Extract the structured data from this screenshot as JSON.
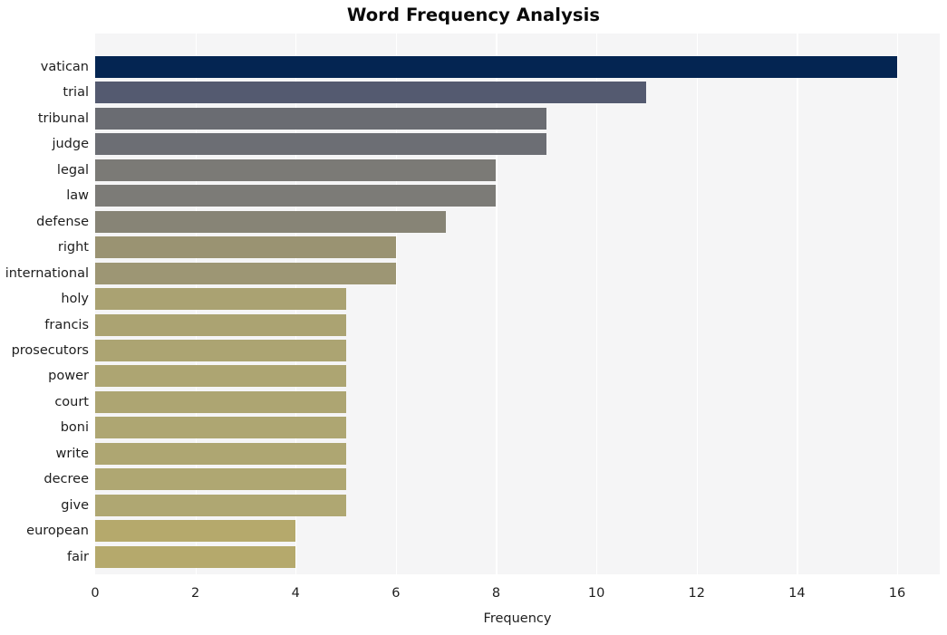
{
  "chart_data": {
    "type": "bar",
    "orientation": "horizontal",
    "title": "Word Frequency Analysis",
    "xlabel": "Frequency",
    "ylabel": "",
    "categories": [
      "vatican",
      "trial",
      "tribunal",
      "judge",
      "legal",
      "law",
      "defense",
      "right",
      "international",
      "holy",
      "francis",
      "prosecutors",
      "power",
      "court",
      "boni",
      "write",
      "decree",
      "give",
      "european",
      "fair"
    ],
    "values": [
      16,
      11,
      9,
      9,
      8,
      8,
      7,
      6,
      6,
      5,
      5,
      5,
      5,
      5,
      5,
      5,
      5,
      5,
      4,
      4
    ],
    "bar_colors": [
      "#042552",
      "#545a70",
      "#6a6c72",
      "#6c6e74",
      "#7b7a76",
      "#7c7b77",
      "#878476",
      "#9a9372",
      "#9d9674",
      "#aaa272",
      "#aba372",
      "#aca472",
      "#ada572",
      "#ada572",
      "#aea672",
      "#aea672",
      "#afa772",
      "#afa772",
      "#b5a96c",
      "#b5a96c"
    ],
    "xticks": [
      0,
      2,
      4,
      6,
      8,
      10,
      12,
      14,
      16
    ],
    "xtick_labels": [
      "0",
      "2",
      "4",
      "6",
      "8",
      "10",
      "12",
      "14",
      "16"
    ],
    "xlim": [
      0,
      16.85
    ],
    "grid": "vertical",
    "legend": "none",
    "plot_background": "#f5f5f6",
    "figure_background": "#ffffff"
  }
}
